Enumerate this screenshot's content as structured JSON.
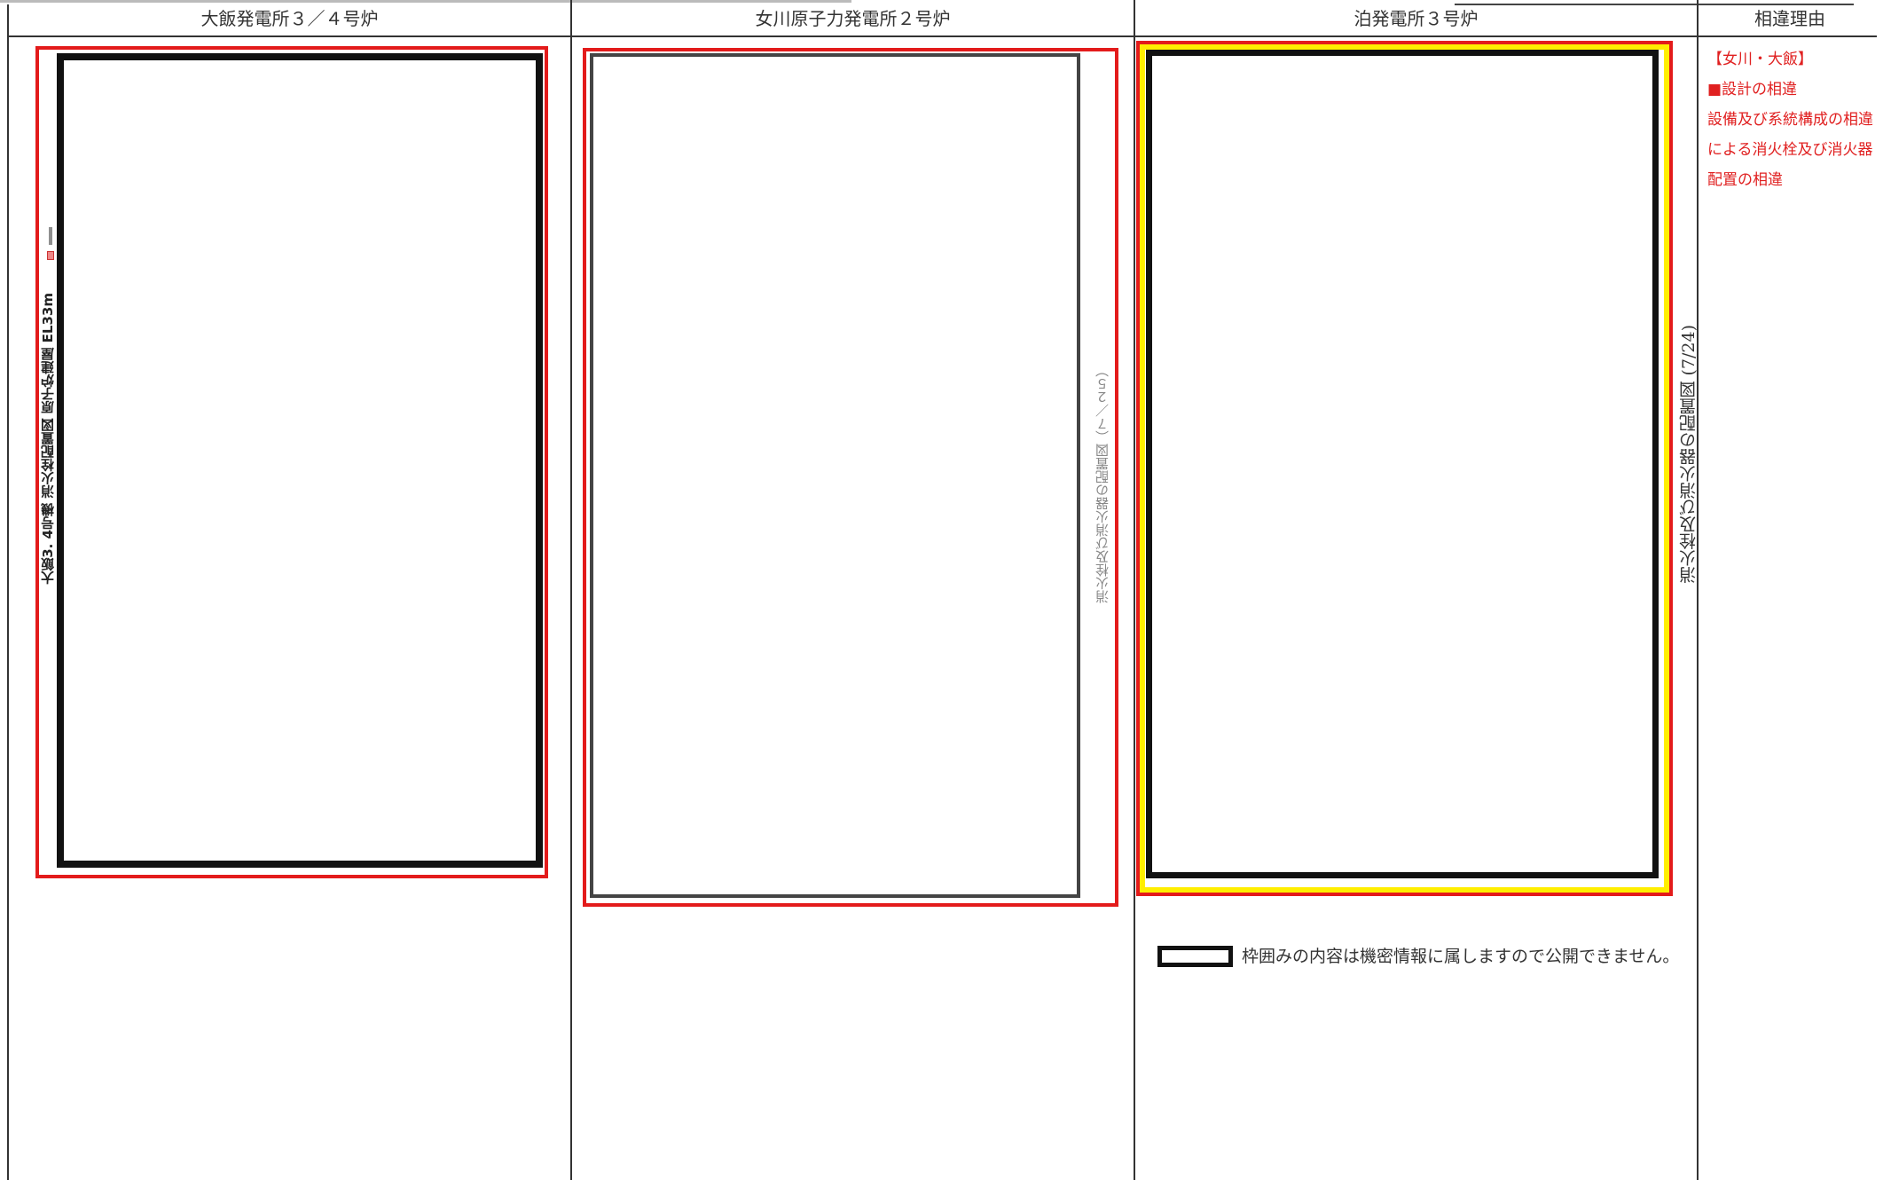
{
  "columns": {
    "ohi": "大飯発電所３／４号炉",
    "onagawa": "女川原子力発電所２号炉",
    "tomari": "泊発電所３号炉",
    "reason": "相違理由"
  },
  "ohi_drawing": {
    "vertical_label": "大飯3. 4号機 消火栓配置図 原子炉建屋 EL33m"
  },
  "onagawa_drawing": {
    "caption": "消火栓及び消火器の配置図（７／２５）"
  },
  "tomari_drawing": {
    "caption": "消火栓及び消火器の配置図 (7/24)"
  },
  "legend": {
    "text": "枠囲みの内容は機密情報に属しますので公開できません。"
  },
  "reason_notes": {
    "plants": "【女川・大飯】",
    "heading": "■設計の相違",
    "body": "設備及び系統構成の相違による消火栓及び消火器配置の相違"
  },
  "colors": {
    "red_frame": "#e31b1b",
    "yellow_frame": "#ffee00",
    "black_frame": "#111111",
    "note_text": "#e02020"
  }
}
